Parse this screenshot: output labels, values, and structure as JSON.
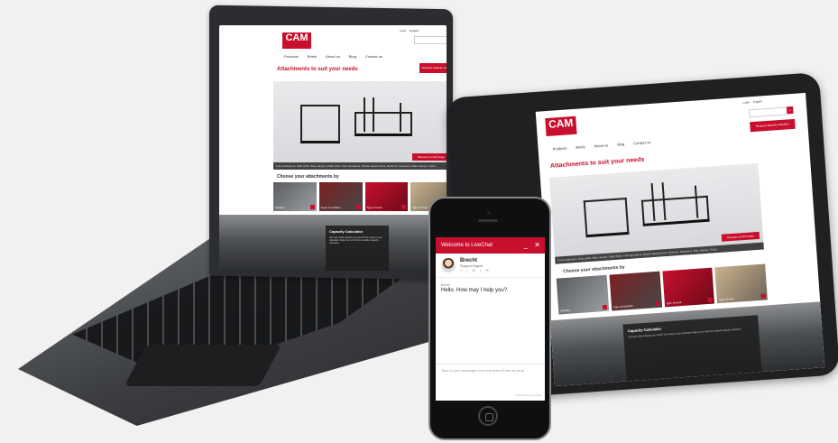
{
  "site": {
    "logo": "CAM",
    "logo_sub": "ATTACHMENTS",
    "nav": [
      "Products",
      "Briefs",
      "About us",
      "Blog",
      "Contact us"
    ],
    "util": [
      "Login",
      "English"
    ],
    "calculator_button": "Readout capacity calculator",
    "heading": "Attachments to suit your needs",
    "hero_caption": "Fork positioners, Side shifts, Bale clamps, Pallet forks, Fork spreaders, Bucket attachments, Rotators, Sweepers, Bale clamps, Forks...",
    "hero_button": "Discover our full range",
    "choose_heading": "Choose your attachments by",
    "thumbs": [
      "Industry",
      "Type of machine",
      "Type of work",
      "Type of load"
    ],
    "calc_title": "Capacity Calculator",
    "calc_text": "Not sure what capacity you need? Our easy-to-use calculator helps you to find the suitable capacity reduction."
  },
  "chat": {
    "header": "Welcome to LiveChat",
    "min": "_",
    "close": "✕",
    "agent_name": "Brecht",
    "agent_role": "Support Agent",
    "agent_icons": "⌂ | ✉ | ☰",
    "msg_from": "Brecht",
    "msg_text": "Hello. How may I help you?",
    "input_placeholder": "Type in your message here and press Enter to send",
    "powered": "Powered by LiveChat"
  },
  "colors": {
    "brand": "#c8102e",
    "background": "#f1f1f1"
  }
}
